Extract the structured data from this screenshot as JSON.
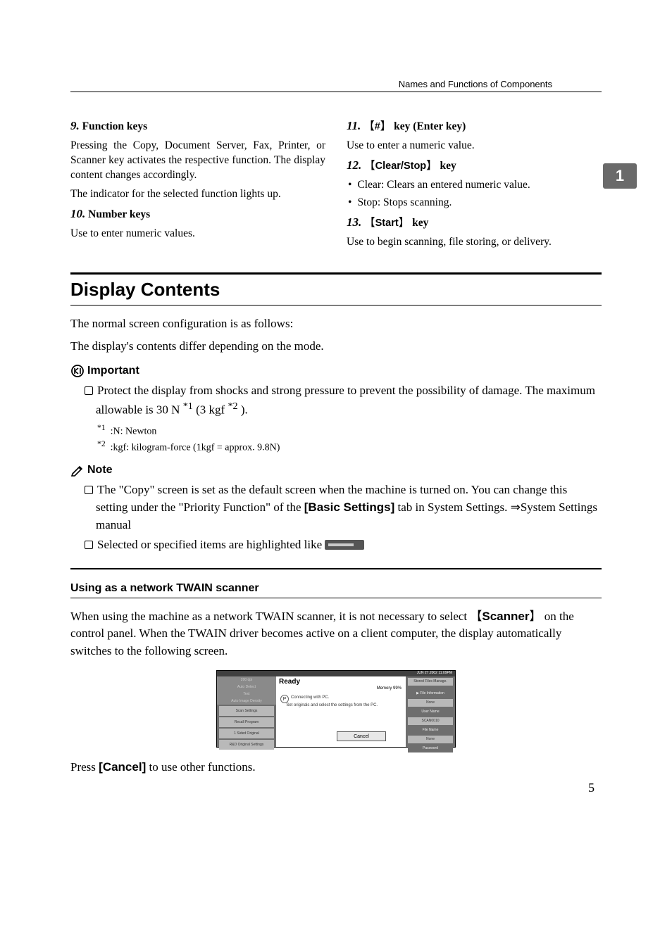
{
  "header": {
    "running": "Names and Functions of Components"
  },
  "sideTab": "1",
  "left": {
    "i9": {
      "num": "9.",
      "title": "Function keys",
      "p1": "Pressing the Copy, Document Server, Fax, Printer, or Scanner key activates the respective function. The display content changes accordingly.",
      "p2": "The indicator for the selected function lights up."
    },
    "i10": {
      "num": "10.",
      "title": "Number keys",
      "p1": "Use to enter numeric values."
    }
  },
  "right": {
    "i11": {
      "num": "11.",
      "key": "#",
      "tail": "key (Enter key)",
      "p1": "Use to enter a numeric value."
    },
    "i12": {
      "num": "12.",
      "key": "Clear/Stop",
      "tail": "key",
      "b1": "Clear: Clears an entered numeric value.",
      "b2": "Stop: Stops scanning."
    },
    "i13": {
      "num": "13.",
      "key": "Start",
      "tail": "key",
      "p1": "Use to begin scanning, file storing, or delivery."
    }
  },
  "section": {
    "title": "Display Contents",
    "p1": "The normal screen configuration is as follows:",
    "p2": "The display's contents differ depending on the mode."
  },
  "important": {
    "label": "Important",
    "text_a": "Protect the display from shocks and strong pressure to prevent the possibility of damage. The maximum allowable is 30 N",
    "text_b": "(3 kgf",
    "text_c": ").",
    "fn1": ":N: Newton",
    "fn2": ":kgf: kilogram-force (1kgf = approx. 9.8N)"
  },
  "note": {
    "label": "Note",
    "n1a": "The \"Copy\" screen is set as the default screen when the machine is turned on. You can change this setting under the \"Priority Function\" of the ",
    "n1b": "[Basic Settings]",
    "n1c": " tab in System Settings. ⇒System Settings manual",
    "n2": "Selected or specified items are highlighted like "
  },
  "subsection": {
    "title": "Using as a network TWAIN scanner",
    "p1a": "When using the machine as a network TWAIN scanner, it is not necessary to select ",
    "p1b": "Scanner",
    "p1c": " on the control panel. When the TWAIN driver becomes active on a client computer, the display automatically switches to the following screen.",
    "p2a": "Press ",
    "p2b": "[Cancel]",
    "p2c": " to use other functions."
  },
  "figure": {
    "ready": "Ready",
    "memory": "Memory 99%",
    "date": "JUN   27.2002  11:09PM",
    "connect1": "Connecting with PC.",
    "connect2": "Set originals and select the settings from the PC.",
    "cancel": "Cancel",
    "leftTabs": [
      "200 dpi",
      "Auto Detect",
      "Text",
      "Auto Image Density"
    ],
    "leftBtns": [
      "Scan Settings",
      "Recall Program",
      "1 Sided Original",
      "R&D Original Settings"
    ],
    "rightTop": "Stored Files Manage.",
    "rightItems": [
      "▶ File Information",
      "None",
      "User Name",
      "SCAN0010",
      "File Name",
      "None",
      "Password"
    ]
  },
  "pageNum": "5"
}
